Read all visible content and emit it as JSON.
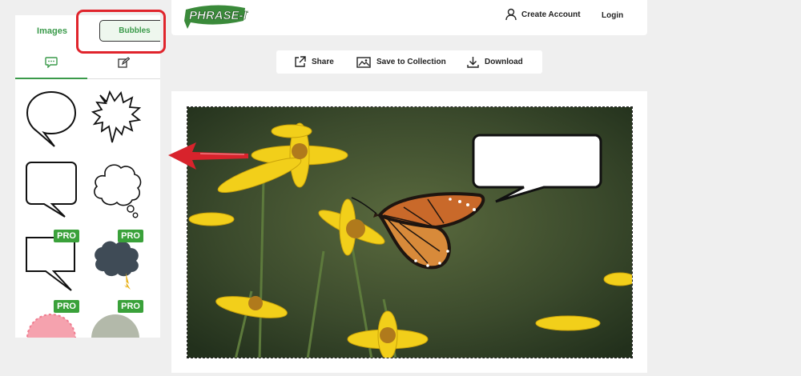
{
  "panel": {
    "tabs": [
      {
        "label": "Images"
      },
      {
        "label": "Bubbles"
      }
    ],
    "subtabs": [
      "speech-bubble-icon",
      "edit-icon"
    ],
    "bubbles": [
      {
        "shape": "oval-speech",
        "pro": ""
      },
      {
        "shape": "burst-speech",
        "pro": ""
      },
      {
        "shape": "rect-speech",
        "pro": ""
      },
      {
        "shape": "cloud-thought",
        "pro": ""
      },
      {
        "shape": "square-speech",
        "pro": "PRO"
      },
      {
        "shape": "dark-cloud",
        "pro": "PRO"
      },
      {
        "shape": "pink-scallop",
        "pro": "PRO"
      },
      {
        "shape": "grey-circle",
        "pro": "PRO"
      }
    ]
  },
  "header": {
    "logo": "PHRASE-IT",
    "create_account": "Create Account",
    "login": "Login"
  },
  "toolbar": {
    "share": "Share",
    "save": "Save to Collection",
    "download": "Download"
  },
  "colors": {
    "brand_green": "#3a9a4a",
    "highlight_red": "#e0242c",
    "pro_badge": "#3aa13a"
  }
}
